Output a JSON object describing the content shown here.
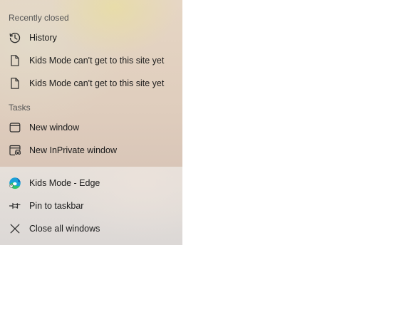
{
  "jumplist": {
    "recent_heading": "Recently closed",
    "recent_items": [
      {
        "label": "History",
        "icon": "history-icon"
      },
      {
        "label": "Kids Mode can't get to this site yet",
        "icon": "page-icon"
      },
      {
        "label": "Kids Mode can't get to this site yet",
        "icon": "page-icon"
      }
    ],
    "tasks_heading": "Tasks",
    "task_items": [
      {
        "label": "New window",
        "icon": "window-icon"
      },
      {
        "label": "New InPrivate window",
        "icon": "inprivate-icon"
      }
    ],
    "app_items": [
      {
        "label": "Kids Mode - Edge",
        "icon": "edge-kids-icon"
      },
      {
        "label": "Pin to taskbar",
        "icon": "pin-icon"
      },
      {
        "label": "Close all windows",
        "icon": "close-icon"
      }
    ]
  }
}
